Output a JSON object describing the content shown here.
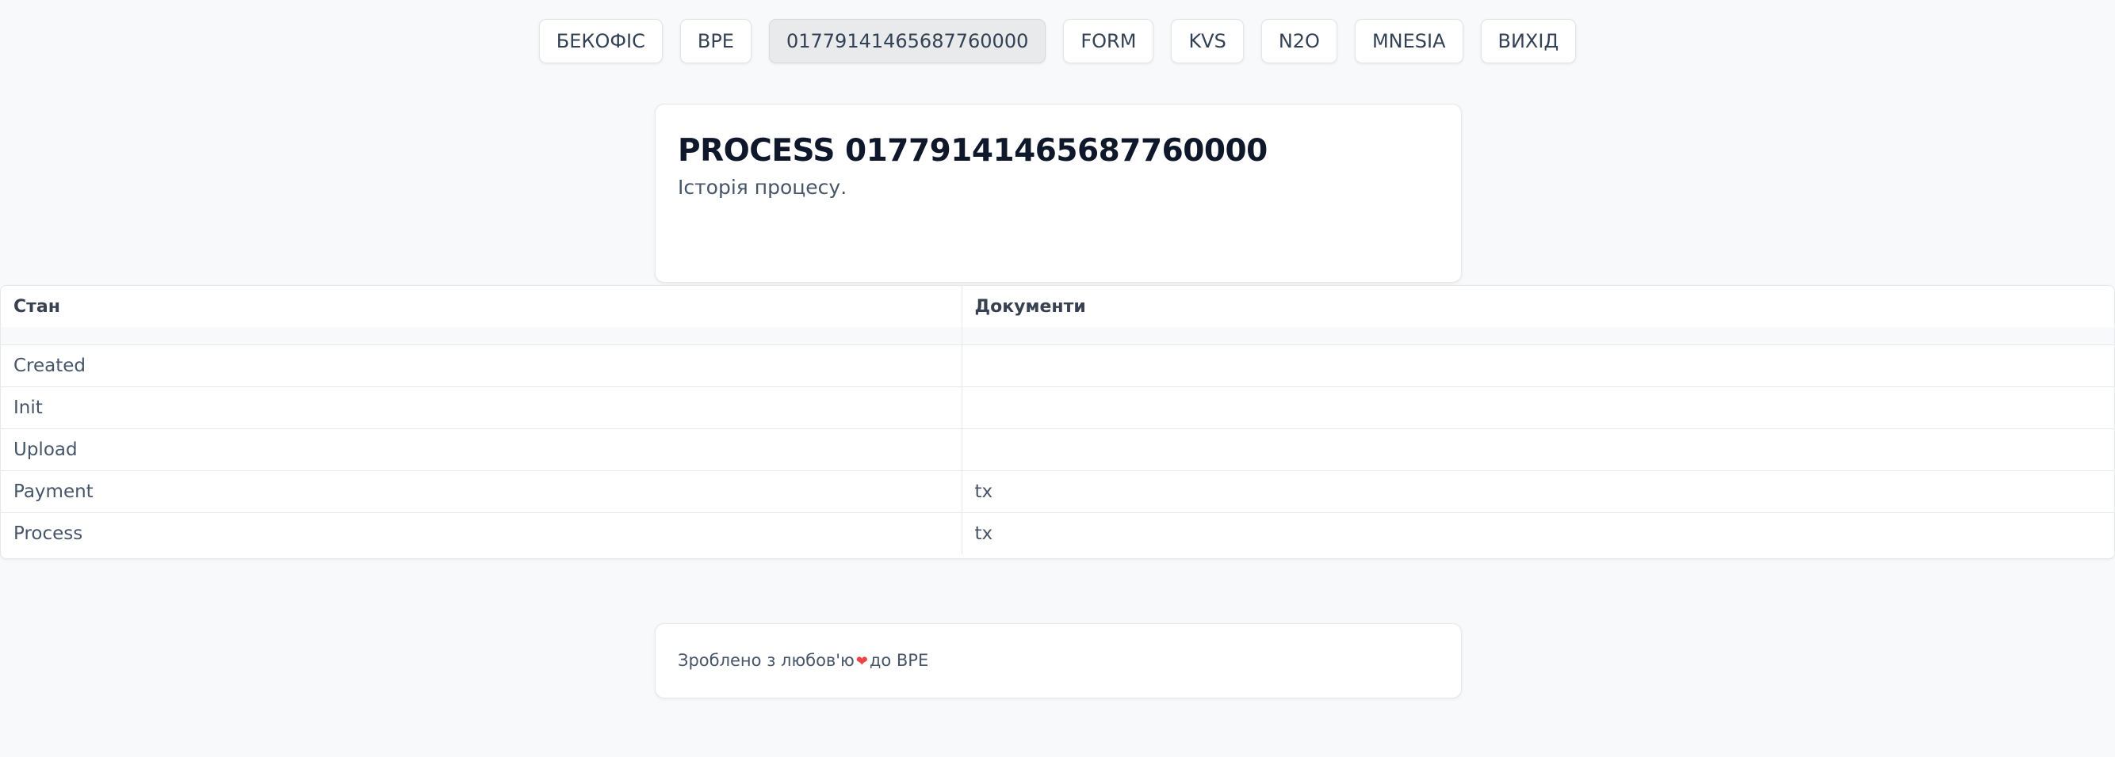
{
  "nav": {
    "items": [
      {
        "label": "БЕКОФІС"
      },
      {
        "label": "BPE"
      },
      {
        "label": "01779141465687760000",
        "active": true
      },
      {
        "label": "FORM"
      },
      {
        "label": "KVS"
      },
      {
        "label": "N2O"
      },
      {
        "label": "MNESIA"
      },
      {
        "label": "ВИХІД"
      }
    ]
  },
  "header": {
    "title": "PROCESS 01779141465687760000",
    "subtitle": "Історія процесу."
  },
  "table": {
    "columns": [
      "Стан",
      "Документи"
    ],
    "rows": [
      {
        "state": "Created",
        "docs": ""
      },
      {
        "state": "Init",
        "docs": ""
      },
      {
        "state": "Upload",
        "docs": ""
      },
      {
        "state": "Payment",
        "docs": "tx"
      },
      {
        "state": "Process",
        "docs": "tx"
      }
    ]
  },
  "footer": {
    "text_before": "Зроблено з любов'ю",
    "heart_icon": "heart-icon",
    "heart_color": "#ef4444",
    "text_after": "до BPE"
  }
}
